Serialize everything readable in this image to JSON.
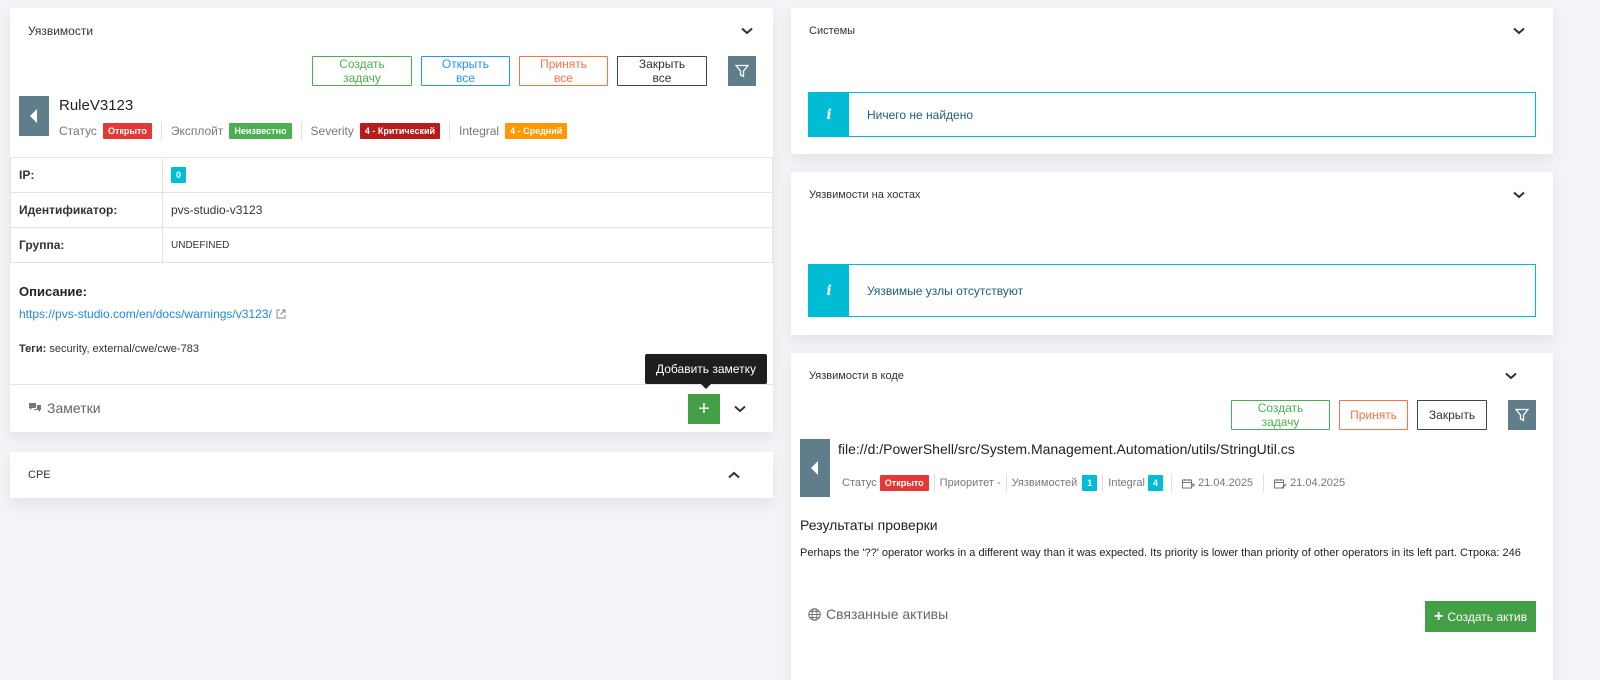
{
  "vuln": {
    "title": "Уязвимости",
    "buttons": {
      "create_task": "Создать задачу",
      "open_all": "Открыть все",
      "accept_all": "Принять все",
      "close_all": "Закрыть все"
    },
    "rule_name": "RuleV3123",
    "meta": {
      "status_label": "Статус",
      "status_value": "Открыто",
      "exploit_label": "Эксплойт",
      "exploit_value": "Неизвестно",
      "severity_label": "Severity",
      "severity_value": "4 - Критический",
      "integral_label": "Integral",
      "integral_value": "4 - Средний"
    },
    "table": [
      {
        "key": "IP:",
        "value": "0"
      },
      {
        "key": "Идентификатор:",
        "value": "pvs-studio-v3123"
      },
      {
        "key": "Группа:",
        "value": "UNDEFINED"
      }
    ],
    "description_label": "Описание:",
    "description_link": "https://pvs-studio.com/en/docs/warnings/v3123/",
    "tags_label": "Теги:",
    "tags_value": "security, external/cwe/cwe-783",
    "notes_label": "Заметки",
    "tooltip": "Добавить заметку",
    "add_symbol": "+"
  },
  "cpe": {
    "title": "CPE"
  },
  "systems": {
    "title": "Системы",
    "alert": "Ничего не найдено"
  },
  "host_vulns": {
    "title": "Уязвимости на хостах",
    "alert": "Уязвимые узлы отсутствуют"
  },
  "code_vulns": {
    "title": "Уязвимости в коде",
    "buttons": {
      "create_task": "Создать задачу",
      "accept": "Принять",
      "close": "Закрыть"
    },
    "file": "file://d:/PowerShell/src/System.Management.Automation/utils/StringUtil.cs",
    "meta": {
      "status_label": "Статус",
      "status_value": "Открыто",
      "priority_label": "Приоритет -",
      "vulns_label": "Уязвимостей",
      "vulns_value": "1",
      "integral_label": "Integral",
      "integral_value": "4",
      "date_created": "21.04.2025",
      "date_updated": "21.04.2025"
    },
    "results_title": "Результаты проверки",
    "results_text": "Perhaps the '??' operator works in a different way than it was expected. Its priority is lower than priority of other operators in its left part. Строка: 246",
    "assets_label": "Связанные активы",
    "create_asset": "Создать актив",
    "add_symbol": "+"
  },
  "icons": {
    "chevron-down": "chevron-down-icon",
    "chevron-up": "chevron-up-icon",
    "filter": "filter-icon",
    "back": "caret-left-icon",
    "info": "info-icon",
    "external-link": "external-link-icon",
    "comments": "comments-icon",
    "globe": "globe-icon",
    "calendar-plus": "calendar-add-icon",
    "calendar-edit": "calendar-edit-icon"
  },
  "colors": {
    "accent_blue": "#2196f3",
    "green": "#4caf50",
    "orange": "#ff7043",
    "slate": "#607d8b",
    "cyan": "#00bcd4",
    "red": "#e53935"
  }
}
